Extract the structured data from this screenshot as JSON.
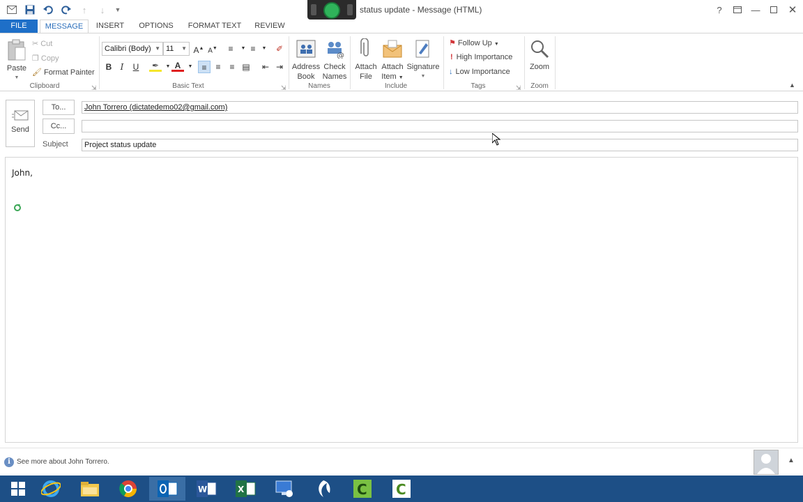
{
  "window": {
    "title": "status update - Message (HTML)"
  },
  "tabs": [
    {
      "label": "FILE"
    },
    {
      "label": "MESSAGE"
    },
    {
      "label": "INSERT"
    },
    {
      "label": "OPTIONS"
    },
    {
      "label": "FORMAT TEXT"
    },
    {
      "label": "REVIEW"
    }
  ],
  "clipboard": {
    "paste": "Paste",
    "cut": "Cut",
    "copy": "Copy",
    "format_painter": "Format Painter",
    "group_label": "Clipboard"
  },
  "basic_text": {
    "font_name": "Calibri (Body)",
    "font_size": "11",
    "group_label": "Basic Text",
    "bold": "B",
    "italic": "I",
    "underline": "U",
    "grow_font": "A",
    "shrink_font": "A",
    "font_color": "A"
  },
  "names": {
    "address_book_line1": "Address",
    "address_book_line2": "Book",
    "check_names_line1": "Check",
    "check_names_line2": "Names",
    "group_label": "Names"
  },
  "include": {
    "attach_file_line1": "Attach",
    "attach_file_line2": "File",
    "attach_item_line1": "Attach",
    "attach_item_line2": "Item",
    "signature": "Signature",
    "group_label": "Include"
  },
  "tags": {
    "follow_up": "Follow Up",
    "high_importance": "High Importance",
    "low_importance": "Low Importance",
    "group_label": "Tags"
  },
  "zoom": {
    "zoom": "Zoom",
    "group_label": "Zoom"
  },
  "header": {
    "send": "Send",
    "to_button": "To...",
    "cc_button": "Cc...",
    "subject_label": "Subject",
    "to_value": "John Torrero (dictatedemo02@gmail.com)",
    "cc_value": "",
    "subject_value": "Project status update"
  },
  "body": {
    "text": "John,"
  },
  "people_pane": {
    "text": "See more about John Torrero.",
    "info_glyph": "i"
  },
  "colors": {
    "accent": "#2a6ebb",
    "file_tab": "#1e6fc8",
    "taskbar": "#1d4f86"
  }
}
